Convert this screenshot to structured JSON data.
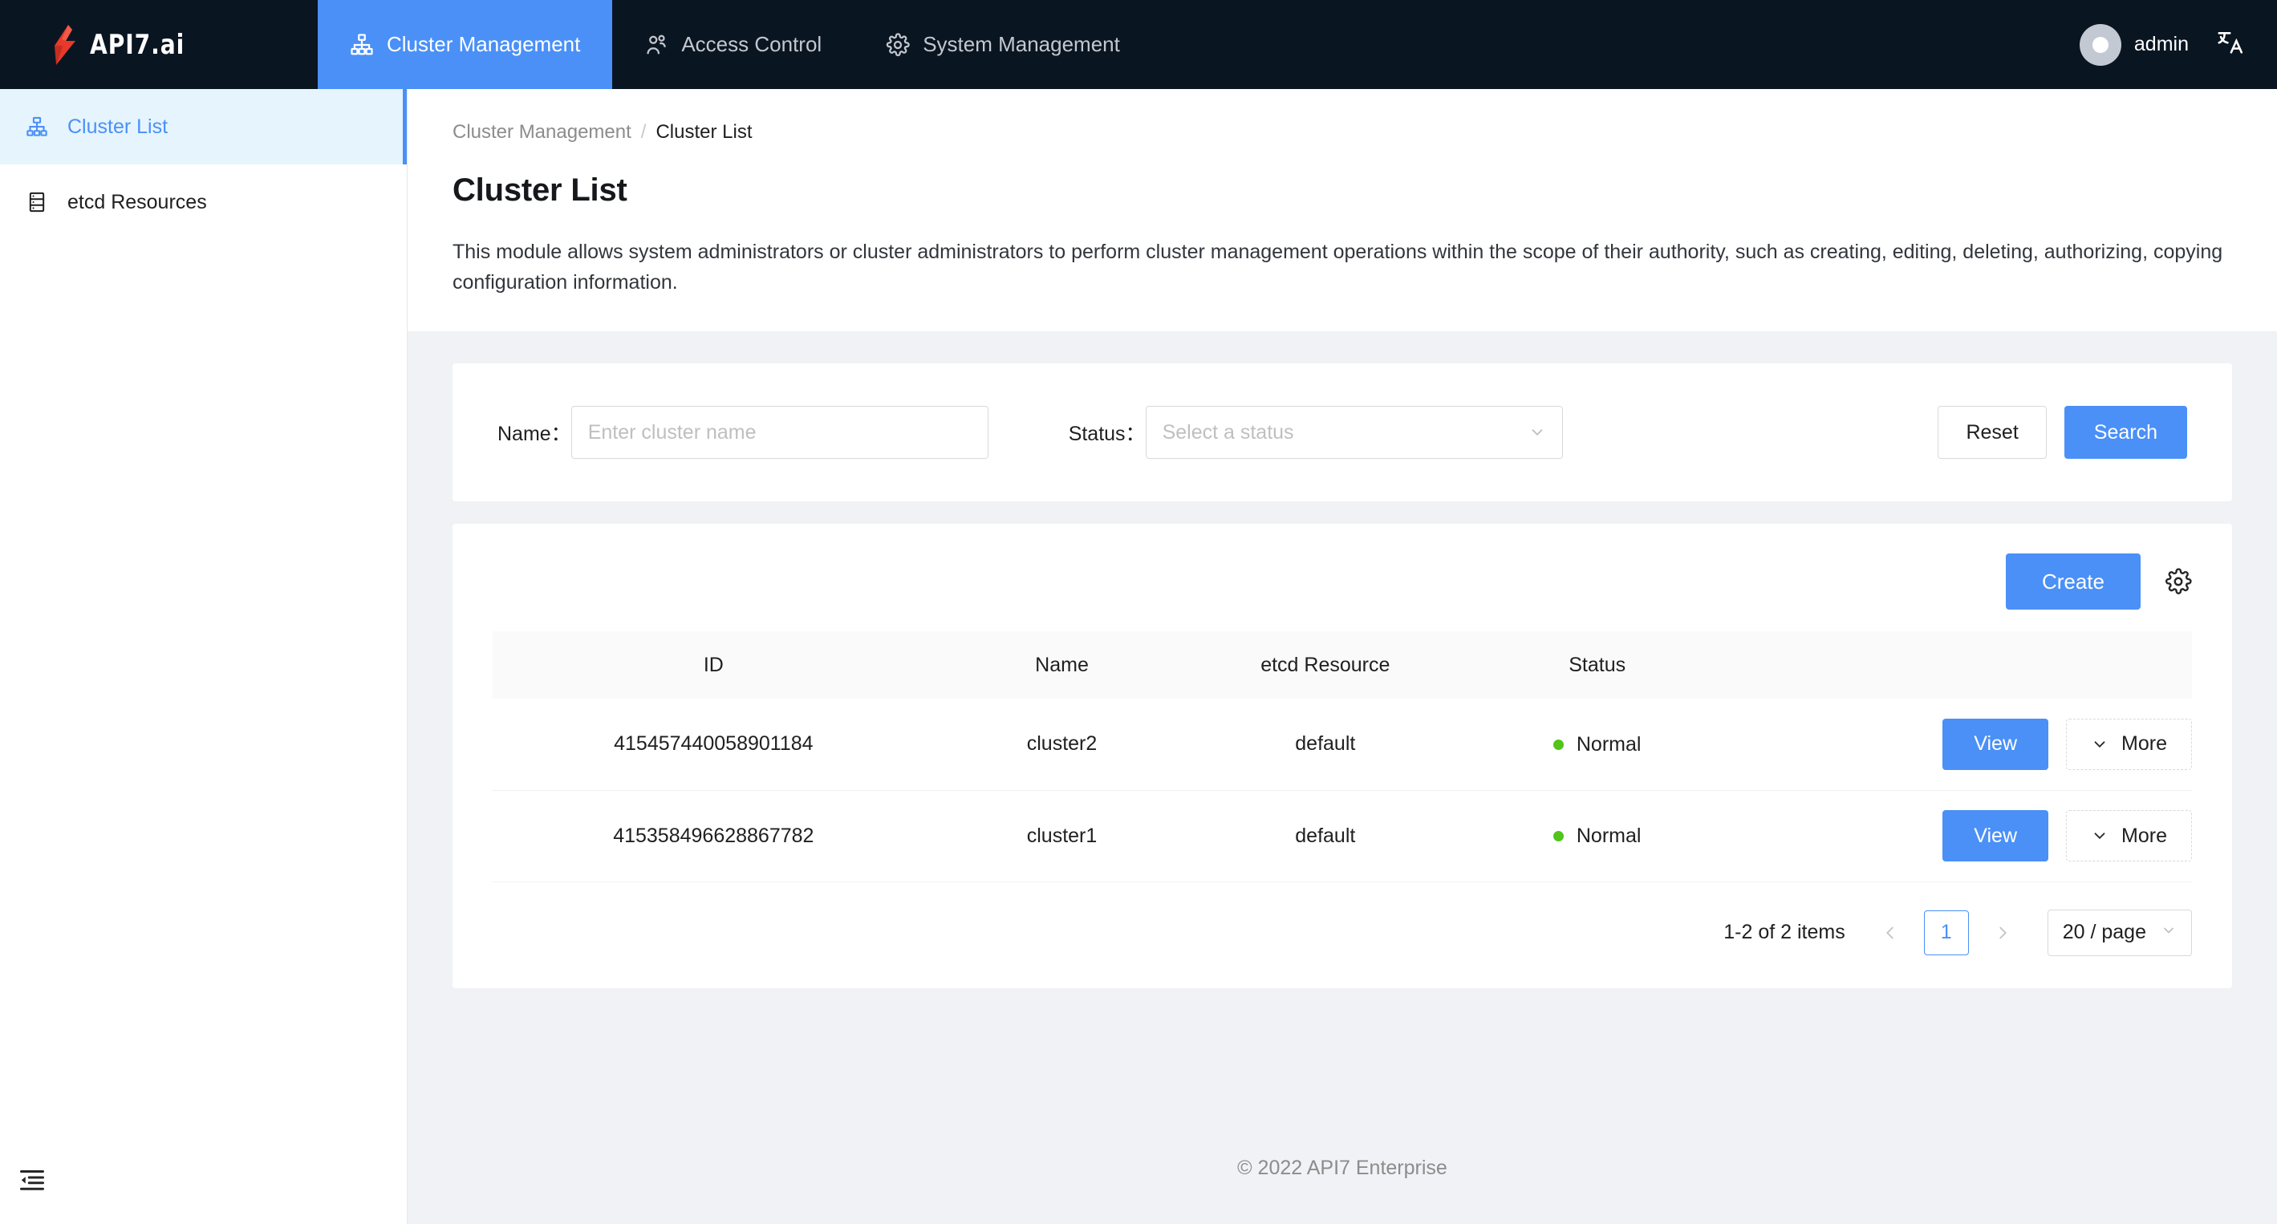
{
  "brand": {
    "name": "API7.ai"
  },
  "topnav": {
    "items": [
      {
        "label": "Cluster Management",
        "icon": "cluster-icon",
        "active": true
      },
      {
        "label": "Access Control",
        "icon": "user-group-icon",
        "active": false
      },
      {
        "label": "System Management",
        "icon": "gear-icon",
        "active": false
      }
    ],
    "user": "admin",
    "language_icon": "translate-icon"
  },
  "sidebar": {
    "items": [
      {
        "label": "Cluster List",
        "icon": "cluster-icon",
        "active": true
      },
      {
        "label": "etcd Resources",
        "icon": "server-icon",
        "active": false
      }
    ],
    "collapse_icon": "menu-fold-icon"
  },
  "breadcrumb": {
    "parent": "Cluster Management",
    "separator": "/",
    "current": "Cluster List"
  },
  "page": {
    "title": "Cluster List",
    "description": "This module allows system administrators or cluster administrators to perform cluster management operations within the scope of their authority, such as creating, editing, deleting, authorizing, copying configuration information."
  },
  "filter": {
    "name_label": "Name：",
    "name_placeholder": "Enter cluster name",
    "status_label": "Status：",
    "status_placeholder": "Select a status",
    "reset_label": "Reset",
    "search_label": "Search"
  },
  "toolbar": {
    "create_label": "Create",
    "settings_icon": "gear-icon"
  },
  "table": {
    "columns": [
      "ID",
      "Name",
      "etcd Resource",
      "Status"
    ],
    "rows": [
      {
        "id": "415457440058901184",
        "name": "cluster2",
        "etcd_resource": "default",
        "status": "Normal",
        "status_color": "#52c41a",
        "view_label": "View",
        "more_label": "More"
      },
      {
        "id": "415358496628867782",
        "name": "cluster1",
        "etcd_resource": "default",
        "status": "Normal",
        "status_color": "#52c41a",
        "view_label": "View",
        "more_label": "More"
      }
    ]
  },
  "pagination": {
    "total_text": "1-2 of 2 items",
    "current_page": "1",
    "page_size": "20 / page"
  },
  "footer": {
    "text": "© 2022 API7 Enterprise"
  },
  "colors": {
    "accent": "#4a90f7",
    "nav_bg": "#0a1522",
    "content_bg": "#f0f2f5",
    "status_normal": "#52c41a",
    "brand_bolt": "#e8392b"
  }
}
